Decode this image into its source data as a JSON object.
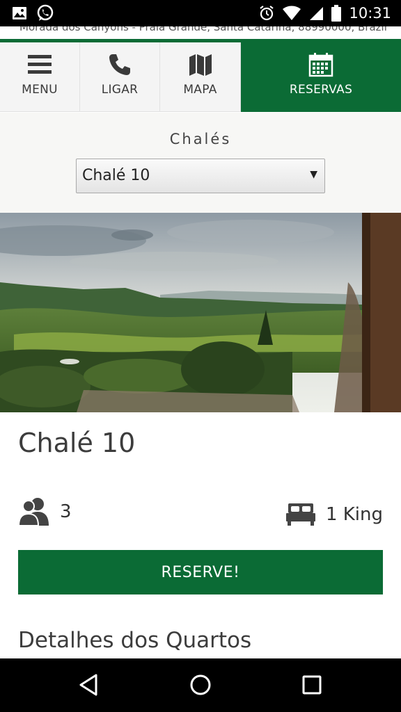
{
  "status_bar": {
    "time": "10:31",
    "left_icons": [
      "image-notification-icon",
      "whatsapp-icon"
    ],
    "right_icons": [
      "alarm-icon",
      "wifi-icon",
      "signal-icon",
      "battery-icon"
    ]
  },
  "address": "Morada dos Canyons - Praia Grande, Santa Catarina, 88990000, Brazil",
  "nav": {
    "items": [
      {
        "label": "MENU",
        "icon": "hamburger-menu-icon"
      },
      {
        "label": "LIGAR",
        "icon": "phone-icon"
      },
      {
        "label": "MAPA",
        "icon": "map-icon"
      },
      {
        "label": "RESERVAS",
        "icon": "calendar-icon"
      }
    ],
    "active_color": "#0b6b35"
  },
  "selector": {
    "label": "Chalés",
    "selected": "Chalé 10"
  },
  "hero": {
    "image": "mountain-valley-landscape-photo"
  },
  "chalet": {
    "title": "Chalé 10",
    "guests": "3",
    "guests_icon": "guests-icon",
    "beds": "1 King",
    "beds_icon": "bed-icon",
    "reserve_label": "RESERVE!",
    "details_heading": "Detalhes dos Quartos"
  },
  "android_nav": [
    "back-icon",
    "home-icon",
    "recent-apps-icon"
  ],
  "colors": {
    "brand_green": "#0b6b35"
  }
}
